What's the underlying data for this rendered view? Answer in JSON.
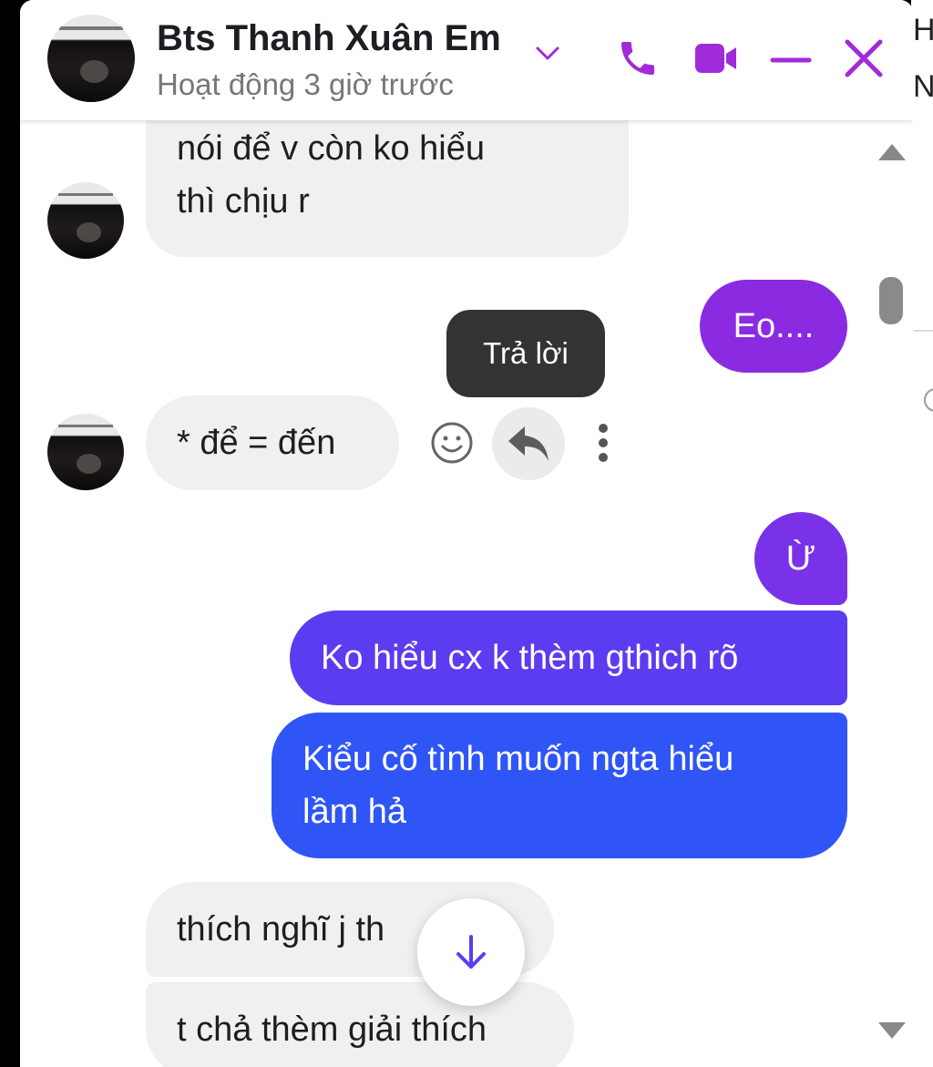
{
  "header": {
    "name": "Bts Thanh Xuân Em",
    "status": "Hoạt động 3 giờ trước"
  },
  "colors": {
    "accent": "#a12bd9",
    "outgoing_purple": "#8a2be2",
    "outgoing_violet": "#5b3cf0",
    "outgoing_blue": "#2f55f6",
    "incoming": "#f0f0f0"
  },
  "icons": [
    "chevron-down-icon",
    "phone-icon",
    "video-icon",
    "minimize-icon",
    "close-icon",
    "smiley-icon",
    "reply-icon",
    "more-vertical-icon",
    "arrow-down-icon",
    "scroll-up-icon",
    "scroll-down-icon"
  ],
  "messages": [
    {
      "from": "them",
      "line1": "nói để v còn ko hiểu",
      "line2": "thì chịu r"
    },
    {
      "from": "me",
      "text": "Eo...."
    },
    {
      "from": "them",
      "text": "* để = đến"
    },
    {
      "from": "me",
      "text": "Ừ"
    },
    {
      "from": "me",
      "text": "Ko hiểu cx k thèm gthich rõ"
    },
    {
      "from": "me",
      "line1": "Kiểu cố tình muốn ngta hiểu",
      "line2": "lầm hả"
    },
    {
      "from": "them",
      "text": "thích nghĩ j th"
    },
    {
      "from": "them",
      "text": "t chả thèm giải thích"
    }
  ],
  "tooltip": {
    "reply_label": "Trả lời"
  },
  "partial_text": {
    "right_top": "H",
    "right_second": "N"
  }
}
